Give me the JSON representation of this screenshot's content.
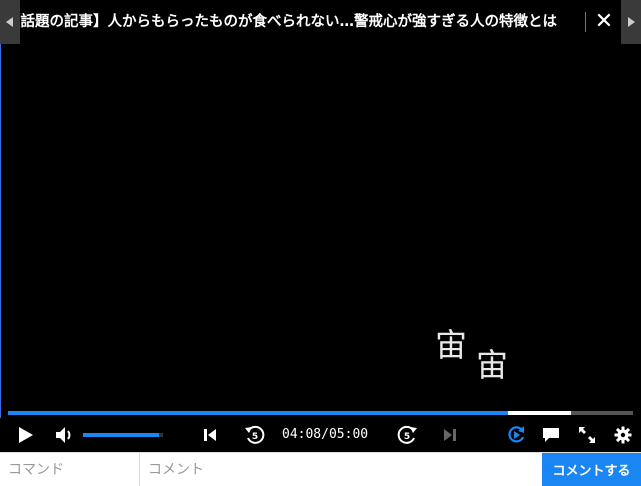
{
  "title_bar": {
    "title": "【話題の記事】人からもらったものが食べられない…警戒心が強すぎる人の特徴とは",
    "prev_icon": "triangle-left-icon",
    "close_label": "✕",
    "next_icon": "triangle-right-icon"
  },
  "comments": [
    {
      "text": "宙"
    },
    {
      "text": "宙"
    }
  ],
  "progress": {
    "played_fraction": 0.8,
    "buffered_fraction": 0.9
  },
  "controls": {
    "play_icon": "play-icon",
    "volume_icon": "volume-icon",
    "volume_level": 0.95,
    "current_time": "04:08",
    "separator": "/",
    "duration": "05:00",
    "rewind_seconds": "5",
    "forward_seconds": "5",
    "accent_color": "#1a86f4"
  },
  "input_row": {
    "command_placeholder": "コマンド",
    "comment_placeholder": "コメント",
    "submit_label": "コメントする"
  }
}
